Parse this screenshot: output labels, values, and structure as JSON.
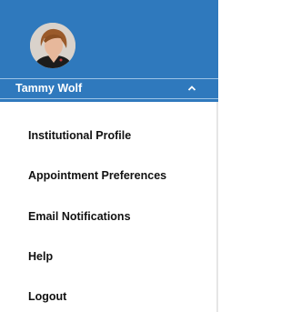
{
  "header": {
    "background_color": "#2f79bd",
    "avatar_icon": "user-avatar-photo",
    "user_name": "Tammy Wolf",
    "toggle_icon": "chevron-up-icon"
  },
  "menu": {
    "items": [
      {
        "label": "Institutional Profile"
      },
      {
        "label": "Appointment Preferences"
      },
      {
        "label": "Email Notifications"
      },
      {
        "label": "Help"
      },
      {
        "label": "Logout"
      }
    ]
  }
}
